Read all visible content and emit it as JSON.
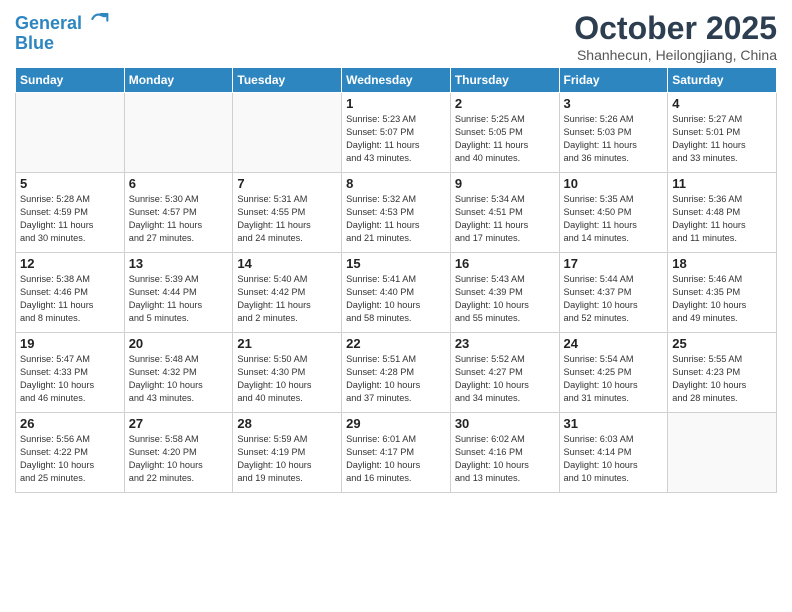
{
  "header": {
    "logo_line1": "General",
    "logo_line2": "Blue",
    "month_title": "October 2025",
    "subtitle": "Shanhecun, Heilongjiang, China"
  },
  "days_of_week": [
    "Sunday",
    "Monday",
    "Tuesday",
    "Wednesday",
    "Thursday",
    "Friday",
    "Saturday"
  ],
  "weeks": [
    [
      {
        "day": "",
        "info": "",
        "empty": true
      },
      {
        "day": "",
        "info": "",
        "empty": true
      },
      {
        "day": "",
        "info": "",
        "empty": true
      },
      {
        "day": "1",
        "info": "Sunrise: 5:23 AM\nSunset: 5:07 PM\nDaylight: 11 hours\nand 43 minutes."
      },
      {
        "day": "2",
        "info": "Sunrise: 5:25 AM\nSunset: 5:05 PM\nDaylight: 11 hours\nand 40 minutes."
      },
      {
        "day": "3",
        "info": "Sunrise: 5:26 AM\nSunset: 5:03 PM\nDaylight: 11 hours\nand 36 minutes."
      },
      {
        "day": "4",
        "info": "Sunrise: 5:27 AM\nSunset: 5:01 PM\nDaylight: 11 hours\nand 33 minutes."
      }
    ],
    [
      {
        "day": "5",
        "info": "Sunrise: 5:28 AM\nSunset: 4:59 PM\nDaylight: 11 hours\nand 30 minutes."
      },
      {
        "day": "6",
        "info": "Sunrise: 5:30 AM\nSunset: 4:57 PM\nDaylight: 11 hours\nand 27 minutes."
      },
      {
        "day": "7",
        "info": "Sunrise: 5:31 AM\nSunset: 4:55 PM\nDaylight: 11 hours\nand 24 minutes."
      },
      {
        "day": "8",
        "info": "Sunrise: 5:32 AM\nSunset: 4:53 PM\nDaylight: 11 hours\nand 21 minutes."
      },
      {
        "day": "9",
        "info": "Sunrise: 5:34 AM\nSunset: 4:51 PM\nDaylight: 11 hours\nand 17 minutes."
      },
      {
        "day": "10",
        "info": "Sunrise: 5:35 AM\nSunset: 4:50 PM\nDaylight: 11 hours\nand 14 minutes."
      },
      {
        "day": "11",
        "info": "Sunrise: 5:36 AM\nSunset: 4:48 PM\nDaylight: 11 hours\nand 11 minutes."
      }
    ],
    [
      {
        "day": "12",
        "info": "Sunrise: 5:38 AM\nSunset: 4:46 PM\nDaylight: 11 hours\nand 8 minutes."
      },
      {
        "day": "13",
        "info": "Sunrise: 5:39 AM\nSunset: 4:44 PM\nDaylight: 11 hours\nand 5 minutes."
      },
      {
        "day": "14",
        "info": "Sunrise: 5:40 AM\nSunset: 4:42 PM\nDaylight: 11 hours\nand 2 minutes."
      },
      {
        "day": "15",
        "info": "Sunrise: 5:41 AM\nSunset: 4:40 PM\nDaylight: 10 hours\nand 58 minutes."
      },
      {
        "day": "16",
        "info": "Sunrise: 5:43 AM\nSunset: 4:39 PM\nDaylight: 10 hours\nand 55 minutes."
      },
      {
        "day": "17",
        "info": "Sunrise: 5:44 AM\nSunset: 4:37 PM\nDaylight: 10 hours\nand 52 minutes."
      },
      {
        "day": "18",
        "info": "Sunrise: 5:46 AM\nSunset: 4:35 PM\nDaylight: 10 hours\nand 49 minutes."
      }
    ],
    [
      {
        "day": "19",
        "info": "Sunrise: 5:47 AM\nSunset: 4:33 PM\nDaylight: 10 hours\nand 46 minutes."
      },
      {
        "day": "20",
        "info": "Sunrise: 5:48 AM\nSunset: 4:32 PM\nDaylight: 10 hours\nand 43 minutes."
      },
      {
        "day": "21",
        "info": "Sunrise: 5:50 AM\nSunset: 4:30 PM\nDaylight: 10 hours\nand 40 minutes."
      },
      {
        "day": "22",
        "info": "Sunrise: 5:51 AM\nSunset: 4:28 PM\nDaylight: 10 hours\nand 37 minutes."
      },
      {
        "day": "23",
        "info": "Sunrise: 5:52 AM\nSunset: 4:27 PM\nDaylight: 10 hours\nand 34 minutes."
      },
      {
        "day": "24",
        "info": "Sunrise: 5:54 AM\nSunset: 4:25 PM\nDaylight: 10 hours\nand 31 minutes."
      },
      {
        "day": "25",
        "info": "Sunrise: 5:55 AM\nSunset: 4:23 PM\nDaylight: 10 hours\nand 28 minutes."
      }
    ],
    [
      {
        "day": "26",
        "info": "Sunrise: 5:56 AM\nSunset: 4:22 PM\nDaylight: 10 hours\nand 25 minutes."
      },
      {
        "day": "27",
        "info": "Sunrise: 5:58 AM\nSunset: 4:20 PM\nDaylight: 10 hours\nand 22 minutes."
      },
      {
        "day": "28",
        "info": "Sunrise: 5:59 AM\nSunset: 4:19 PM\nDaylight: 10 hours\nand 19 minutes."
      },
      {
        "day": "29",
        "info": "Sunrise: 6:01 AM\nSunset: 4:17 PM\nDaylight: 10 hours\nand 16 minutes."
      },
      {
        "day": "30",
        "info": "Sunrise: 6:02 AM\nSunset: 4:16 PM\nDaylight: 10 hours\nand 13 minutes."
      },
      {
        "day": "31",
        "info": "Sunrise: 6:03 AM\nSunset: 4:14 PM\nDaylight: 10 hours\nand 10 minutes."
      },
      {
        "day": "",
        "info": "",
        "empty": true
      }
    ]
  ]
}
